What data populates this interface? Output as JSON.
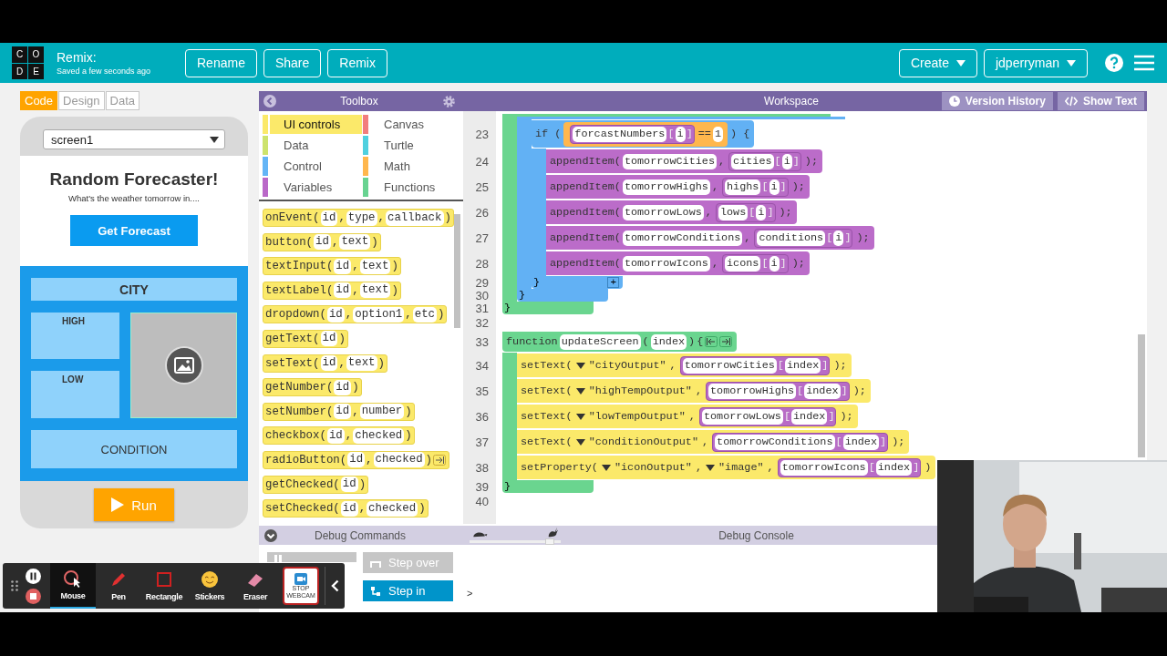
{
  "header": {
    "logo_letters": [
      "C",
      "O",
      "D",
      "E"
    ],
    "title": "Remix:",
    "subtitle": "Saved a few seconds ago",
    "buttons": [
      "Rename",
      "Share",
      "Remix"
    ],
    "menus": [
      "Create",
      "jdperryman"
    ]
  },
  "mode_tabs": [
    {
      "label": "Code",
      "selected": true
    },
    {
      "label": "Design",
      "selected": false
    },
    {
      "label": "Data",
      "selected": false
    }
  ],
  "app_preview": {
    "screen_select": "screen1",
    "title": "Random Forecaster!",
    "subtitle": "What's the weather tomorrow in....",
    "button": "Get Forecast",
    "city_label": "CITY",
    "high_label": "HIGH",
    "low_label": "LOW",
    "condition_label": "CONDITION",
    "run_button": "Run"
  },
  "toolbox": {
    "title": "Toolbox",
    "categories": [
      {
        "label": "UI controls",
        "color": "#fbe96a",
        "selected": true
      },
      {
        "label": "Canvas",
        "color": "#f27d7d",
        "selected": false
      },
      {
        "label": "Data",
        "color": "#cde36c",
        "selected": false
      },
      {
        "label": "Turtle",
        "color": "#4fd0df",
        "selected": false
      },
      {
        "label": "Control",
        "color": "#64b5f6",
        "selected": false
      },
      {
        "label": "Math",
        "color": "#ffb74d",
        "selected": false
      },
      {
        "label": "Variables",
        "color": "#ba68c8",
        "selected": false
      },
      {
        "label": "Functions",
        "color": "#68d391",
        "selected": false
      }
    ],
    "blocks": [
      {
        "tokens": [
          {
            "kind": "plain",
            "text": "onEvent("
          },
          {
            "kind": "pill",
            "text": "id"
          },
          {
            "kind": "plain",
            "text": ","
          },
          {
            "kind": "pill",
            "text": "type"
          },
          {
            "kind": "plain",
            "text": ","
          },
          {
            "kind": "pill",
            "text": "callback"
          },
          {
            "kind": "plain",
            "text": ")"
          }
        ]
      },
      {
        "tokens": [
          {
            "kind": "plain",
            "text": "button("
          },
          {
            "kind": "pill",
            "text": "id"
          },
          {
            "kind": "plain",
            "text": ","
          },
          {
            "kind": "pill",
            "text": "text"
          },
          {
            "kind": "plain",
            "text": ")"
          }
        ]
      },
      {
        "tokens": [
          {
            "kind": "plain",
            "text": "textInput("
          },
          {
            "kind": "pill",
            "text": "id"
          },
          {
            "kind": "plain",
            "text": ","
          },
          {
            "kind": "pill",
            "text": "text"
          },
          {
            "kind": "plain",
            "text": ")"
          }
        ]
      },
      {
        "tokens": [
          {
            "kind": "plain",
            "text": "textLabel("
          },
          {
            "kind": "pill",
            "text": "id"
          },
          {
            "kind": "plain",
            "text": ","
          },
          {
            "kind": "pill",
            "text": "text"
          },
          {
            "kind": "plain",
            "text": ")"
          }
        ]
      },
      {
        "tokens": [
          {
            "kind": "plain",
            "text": "dropdown("
          },
          {
            "kind": "pill",
            "text": "id"
          },
          {
            "kind": "plain",
            "text": ","
          },
          {
            "kind": "pill",
            "text": "option1"
          },
          {
            "kind": "plain",
            "text": ","
          },
          {
            "kind": "pill",
            "text": "etc"
          },
          {
            "kind": "plain",
            "text": ")"
          }
        ]
      },
      {
        "tokens": [
          {
            "kind": "plain",
            "text": "getText("
          },
          {
            "kind": "pill",
            "text": "id"
          },
          {
            "kind": "plain",
            "text": ")"
          }
        ]
      },
      {
        "tokens": [
          {
            "kind": "plain",
            "text": "setText("
          },
          {
            "kind": "pill",
            "text": "id"
          },
          {
            "kind": "plain",
            "text": ","
          },
          {
            "kind": "pill",
            "text": "text"
          },
          {
            "kind": "plain",
            "text": ")"
          }
        ]
      },
      {
        "tokens": [
          {
            "kind": "plain",
            "text": "getNumber("
          },
          {
            "kind": "pill",
            "text": "id"
          },
          {
            "kind": "plain",
            "text": ")"
          }
        ]
      },
      {
        "tokens": [
          {
            "kind": "plain",
            "text": "setNumber("
          },
          {
            "kind": "pill",
            "text": "id"
          },
          {
            "kind": "plain",
            "text": ","
          },
          {
            "kind": "pill",
            "text": "number"
          },
          {
            "kind": "plain",
            "text": ")"
          }
        ]
      },
      {
        "tokens": [
          {
            "kind": "plain",
            "text": "checkbox("
          },
          {
            "kind": "pill",
            "text": "id"
          },
          {
            "kind": "plain",
            "text": ","
          },
          {
            "kind": "pill",
            "text": "checked"
          },
          {
            "kind": "plain",
            "text": ")"
          }
        ]
      },
      {
        "tokens": [
          {
            "kind": "plain",
            "text": "radioButton("
          },
          {
            "kind": "pill",
            "text": "id"
          },
          {
            "kind": "plain",
            "text": ","
          },
          {
            "kind": "pill",
            "text": "checked"
          },
          {
            "kind": "plain",
            "text": ")"
          },
          {
            "kind": "arrow"
          }
        ]
      },
      {
        "tokens": [
          {
            "kind": "plain",
            "text": "getChecked("
          },
          {
            "kind": "pill",
            "text": "id"
          },
          {
            "kind": "plain",
            "text": ")"
          }
        ]
      },
      {
        "tokens": [
          {
            "kind": "plain",
            "text": "setChecked("
          },
          {
            "kind": "pill",
            "text": "id"
          },
          {
            "kind": "plain",
            "text": ","
          },
          {
            "kind": "pill",
            "text": "checked"
          },
          {
            "kind": "plain",
            "text": ")"
          }
        ]
      }
    ]
  },
  "workspace": {
    "title": "Workspace",
    "buttons": [
      "Version History",
      "Show Text"
    ],
    "code": [
      {
        "kind": "function",
        "children": [
          {
            "kind": "loop",
            "children": [
              {
                "kind": "if",
                "number": "23",
                "tokens": [
                  {
                    "kind": "plain",
                    "text": "if ("
                  },
                  {
                    "kind": "compare",
                    "parts": [
                      {
                        "kind": "array",
                        "parts": [
                          {
                            "kind": "pill",
                            "text": "forcastNumbers"
                          },
                          {
                            "kind": "plain",
                            "text": "["
                          },
                          {
                            "kind": "pill",
                            "text": "i"
                          },
                          {
                            "kind": "plain",
                            "text": "]"
                          }
                        ]
                      },
                      {
                        "kind": "plain",
                        "text": "=="
                      },
                      {
                        "kind": "pill",
                        "text": "1"
                      }
                    ]
                  },
                  {
                    "kind": "plain",
                    "text": ") {"
                  }
                ],
                "children": [
                  {
                    "kind": "list-call",
                    "number": "24",
                    "tokens": [
                      {
                        "kind": "plain",
                        "text": "appendItem("
                      },
                      {
                        "kind": "pill",
                        "text": "tomorrowCities"
                      },
                      {
                        "kind": "plain",
                        "text": ","
                      },
                      {
                        "kind": "array",
                        "parts": [
                          {
                            "kind": "pill",
                            "text": "cities"
                          },
                          {
                            "kind": "plain",
                            "text": "["
                          },
                          {
                            "kind": "pill",
                            "text": "i"
                          },
                          {
                            "kind": "plain",
                            "text": "]"
                          }
                        ]
                      },
                      {
                        "kind": "plain",
                        "text": ");"
                      }
                    ]
                  },
                  {
                    "kind": "list-call",
                    "number": "25",
                    "tokens": [
                      {
                        "kind": "plain",
                        "text": "appendItem("
                      },
                      {
                        "kind": "pill",
                        "text": "tomorrowHighs"
                      },
                      {
                        "kind": "plain",
                        "text": ","
                      },
                      {
                        "kind": "array",
                        "parts": [
                          {
                            "kind": "pill",
                            "text": "highs"
                          },
                          {
                            "kind": "plain",
                            "text": "["
                          },
                          {
                            "kind": "pill",
                            "text": "i"
                          },
                          {
                            "kind": "plain",
                            "text": "]"
                          }
                        ]
                      },
                      {
                        "kind": "plain",
                        "text": ");"
                      }
                    ]
                  },
                  {
                    "kind": "list-call",
                    "number": "26",
                    "tokens": [
                      {
                        "kind": "plain",
                        "text": "appendItem("
                      },
                      {
                        "kind": "pill",
                        "text": "tomorrowLows"
                      },
                      {
                        "kind": "plain",
                        "text": ","
                      },
                      {
                        "kind": "array",
                        "parts": [
                          {
                            "kind": "pill",
                            "text": "lows"
                          },
                          {
                            "kind": "plain",
                            "text": "["
                          },
                          {
                            "kind": "pill",
                            "text": "i"
                          },
                          {
                            "kind": "plain",
                            "text": "]"
                          }
                        ]
                      },
                      {
                        "kind": "plain",
                        "text": ");"
                      }
                    ]
                  },
                  {
                    "kind": "list-call",
                    "number": "27",
                    "tokens": [
                      {
                        "kind": "plain",
                        "text": "appendItem("
                      },
                      {
                        "kind": "pill",
                        "text": "tomorrowConditions"
                      },
                      {
                        "kind": "plain",
                        "text": ","
                      },
                      {
                        "kind": "array",
                        "parts": [
                          {
                            "kind": "pill",
                            "text": "conditions"
                          },
                          {
                            "kind": "plain",
                            "text": "["
                          },
                          {
                            "kind": "pill",
                            "text": "i"
                          },
                          {
                            "kind": "plain",
                            "text": "]"
                          }
                        ]
                      },
                      {
                        "kind": "plain",
                        "text": ");"
                      }
                    ]
                  },
                  {
                    "kind": "list-call",
                    "number": "28",
                    "tokens": [
                      {
                        "kind": "plain",
                        "text": "appendItem("
                      },
                      {
                        "kind": "pill",
                        "text": "tomorrowIcons"
                      },
                      {
                        "kind": "plain",
                        "text": ","
                      },
                      {
                        "kind": "array",
                        "parts": [
                          {
                            "kind": "pill",
                            "text": "icons"
                          },
                          {
                            "kind": "plain",
                            "text": "["
                          },
                          {
                            "kind": "pill",
                            "text": "i"
                          },
                          {
                            "kind": "plain",
                            "text": "]"
                          }
                        ]
                      },
                      {
                        "kind": "plain",
                        "text": ");"
                      }
                    ]
                  }
                ],
                "close": {
                  "number": "29",
                  "text": "}",
                  "expand": "+"
                }
              }
            ],
            "close": {
              "number": "30",
              "text": "}"
            }
          }
        ],
        "close": {
          "number": "31",
          "text": "}"
        }
      },
      {
        "kind": "blank",
        "number": "32"
      },
      {
        "kind": "function",
        "number": "33",
        "tokens": [
          {
            "kind": "plain",
            "text": "function"
          },
          {
            "kind": "pill",
            "text": "updateScreen"
          },
          {
            "kind": "plain",
            "text": "("
          },
          {
            "kind": "pill",
            "text": "index"
          },
          {
            "kind": "plain",
            "text": ")"
          },
          {
            "kind": "plain",
            "text": "{"
          },
          {
            "kind": "arrows"
          }
        ],
        "children": [
          {
            "kind": "ui-call",
            "number": "34",
            "tokens": [
              {
                "kind": "plain",
                "text": "setText("
              },
              {
                "kind": "dropdown",
                "text": "\"cityOutput\""
              },
              {
                "kind": "plain",
                "text": ","
              },
              {
                "kind": "array",
                "parts": [
                  {
                    "kind": "pill",
                    "text": "tomorrowCities"
                  },
                  {
                    "kind": "plain",
                    "text": "["
                  },
                  {
                    "kind": "pill",
                    "text": "index"
                  },
                  {
                    "kind": "plain",
                    "text": "]"
                  }
                ]
              },
              {
                "kind": "plain",
                "text": ");"
              }
            ]
          },
          {
            "kind": "ui-call",
            "number": "35",
            "tokens": [
              {
                "kind": "plain",
                "text": "setText("
              },
              {
                "kind": "dropdown",
                "text": "\"highTempOutput\""
              },
              {
                "kind": "plain",
                "text": ","
              },
              {
                "kind": "array",
                "parts": [
                  {
                    "kind": "pill",
                    "text": "tomorrowHighs"
                  },
                  {
                    "kind": "plain",
                    "text": "["
                  },
                  {
                    "kind": "pill",
                    "text": "index"
                  },
                  {
                    "kind": "plain",
                    "text": "]"
                  }
                ]
              },
              {
                "kind": "plain",
                "text": ");"
              }
            ]
          },
          {
            "kind": "ui-call",
            "number": "36",
            "tokens": [
              {
                "kind": "plain",
                "text": "setText("
              },
              {
                "kind": "dropdown",
                "text": "\"lowTempOutput\""
              },
              {
                "kind": "plain",
                "text": ","
              },
              {
                "kind": "array",
                "parts": [
                  {
                    "kind": "pill",
                    "text": "tomorrowLows"
                  },
                  {
                    "kind": "plain",
                    "text": "["
                  },
                  {
                    "kind": "pill",
                    "text": "index"
                  },
                  {
                    "kind": "plain",
                    "text": "]"
                  }
                ]
              },
              {
                "kind": "plain",
                "text": ");"
              }
            ]
          },
          {
            "kind": "ui-call",
            "number": "37",
            "tokens": [
              {
                "kind": "plain",
                "text": "setText("
              },
              {
                "kind": "dropdown",
                "text": "\"conditionOutput\""
              },
              {
                "kind": "plain",
                "text": ","
              },
              {
                "kind": "array",
                "parts": [
                  {
                    "kind": "pill",
                    "text": "tomorrowConditions"
                  },
                  {
                    "kind": "plain",
                    "text": "["
                  },
                  {
                    "kind": "pill",
                    "text": "index"
                  },
                  {
                    "kind": "plain",
                    "text": "]"
                  }
                ]
              },
              {
                "kind": "plain",
                "text": ");"
              }
            ]
          },
          {
            "kind": "ui-call",
            "number": "38",
            "tokens": [
              {
                "kind": "plain",
                "text": "setProperty("
              },
              {
                "kind": "dropdown",
                "text": "\"iconOutput\""
              },
              {
                "kind": "plain",
                "text": ","
              },
              {
                "kind": "dropdown",
                "text": "\"image\""
              },
              {
                "kind": "plain",
                "text": ","
              },
              {
                "kind": "array",
                "parts": [
                  {
                    "kind": "pill",
                    "text": "tomorrowIcons"
                  },
                  {
                    "kind": "plain",
                    "text": "["
                  },
                  {
                    "kind": "pill",
                    "text": "index"
                  },
                  {
                    "kind": "plain",
                    "text": "]"
                  }
                ]
              },
              {
                "kind": "plain",
                "text": ")"
              }
            ]
          }
        ],
        "close": {
          "number": "39",
          "text": "}"
        }
      },
      {
        "kind": "blank",
        "number": "40"
      }
    ]
  },
  "debug": {
    "commands_title": "Debug Commands",
    "buttons": [
      {
        "kind": "break",
        "disabled": true
      },
      {
        "kind": "step-over",
        "label": "Step over",
        "disabled": true
      },
      {
        "kind": "step-in",
        "label": "Step in",
        "disabled": false
      }
    ],
    "console_title": "Debug Console",
    "speed": {
      "level": 0.92
    },
    "prompt": ">"
  },
  "recorder": {
    "tools": [
      {
        "kind": "mouse",
        "label": "Mouse",
        "selected": true
      },
      {
        "kind": "pen",
        "label": "Pen",
        "selected": false
      },
      {
        "kind": "rectangle",
        "label": "Rectangle",
        "selected": false
      },
      {
        "kind": "stickers",
        "label": "Stickers",
        "selected": false
      },
      {
        "kind": "eraser",
        "label": "Eraser",
        "selected": false
      }
    ],
    "webcam_button": "STOP WEBCAM"
  }
}
